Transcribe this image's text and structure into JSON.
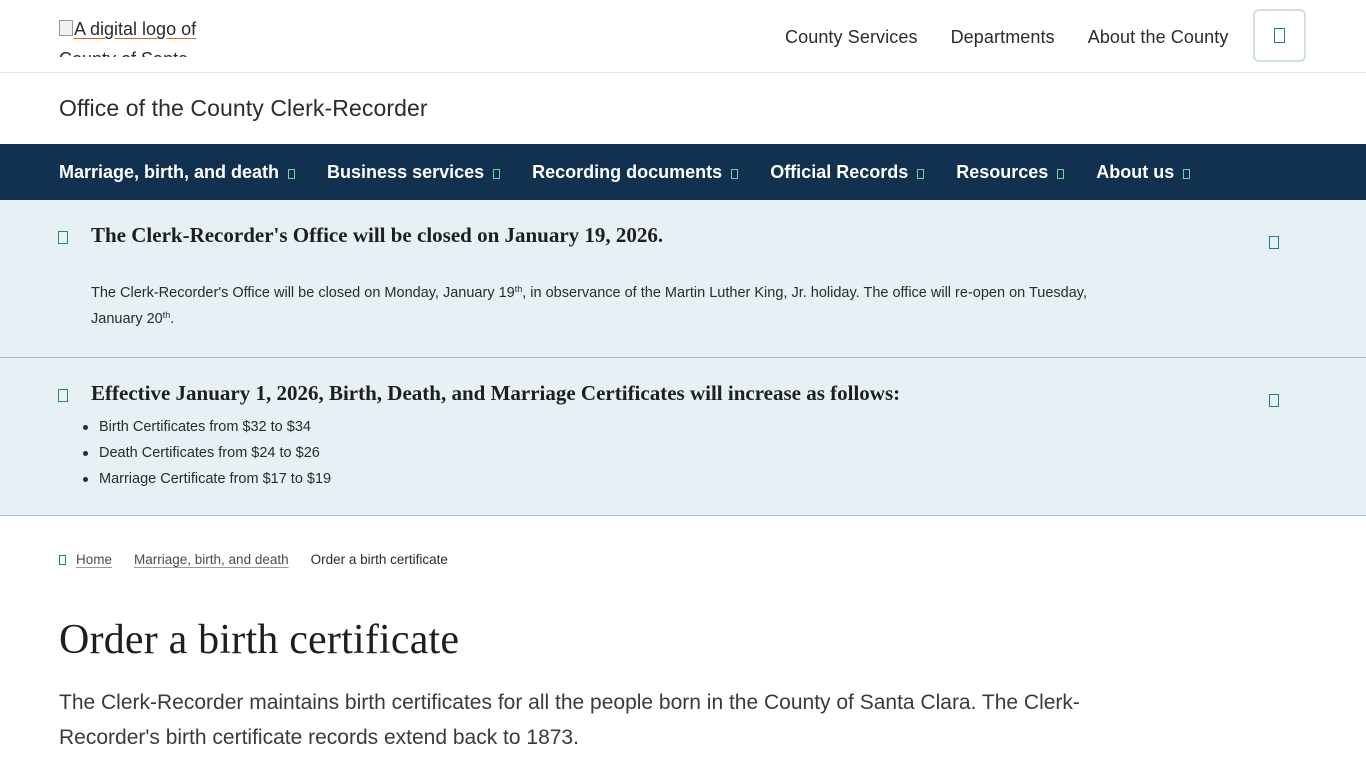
{
  "header": {
    "logo_alt": "A digital logo of County of Santa Clara",
    "nav": [
      "County Services",
      "Departments",
      "About the County"
    ]
  },
  "department": {
    "title": "Office of the County Clerk-Recorder"
  },
  "main_nav": [
    "Marriage, birth, and death",
    "Business services",
    "Recording documents",
    "Official Records",
    "Resources",
    "About us"
  ],
  "alerts": [
    {
      "title": "The Clerk-Recorder's Office will be closed on January 19, 2026.",
      "body_part1": "The Clerk-Recorder's Office will be closed on Monday, January 19",
      "body_sup1": "th",
      "body_part2": ", in observance of the Martin Luther King, Jr. holiday.  The office will re-open on Tuesday, January 20",
      "body_sup2": "th",
      "body_part3": "."
    },
    {
      "title": "Effective January 1, 2026, Birth, Death, and Marriage Certificates will increase as follows:",
      "items": [
        "Birth Certificates from $32 to $34",
        "Death Certificates from $24 to $26",
        "Marriage Certificate from $17 to $19"
      ]
    }
  ],
  "breadcrumb": {
    "home": "Home",
    "parent": "Marriage, birth, and death",
    "current": "Order a birth certificate"
  },
  "page": {
    "title": "Order a birth certificate",
    "intro": "The Clerk-Recorder maintains birth certificates for all the people born in the County of Santa Clara. The Clerk-Recorder's birth certificate records extend back to 1873."
  },
  "colors": {
    "nav_background": "#12304f",
    "alert_background": "#e6f0f5",
    "accent_green": "#6fd3a5",
    "accent_teal": "#1f7f8f"
  }
}
